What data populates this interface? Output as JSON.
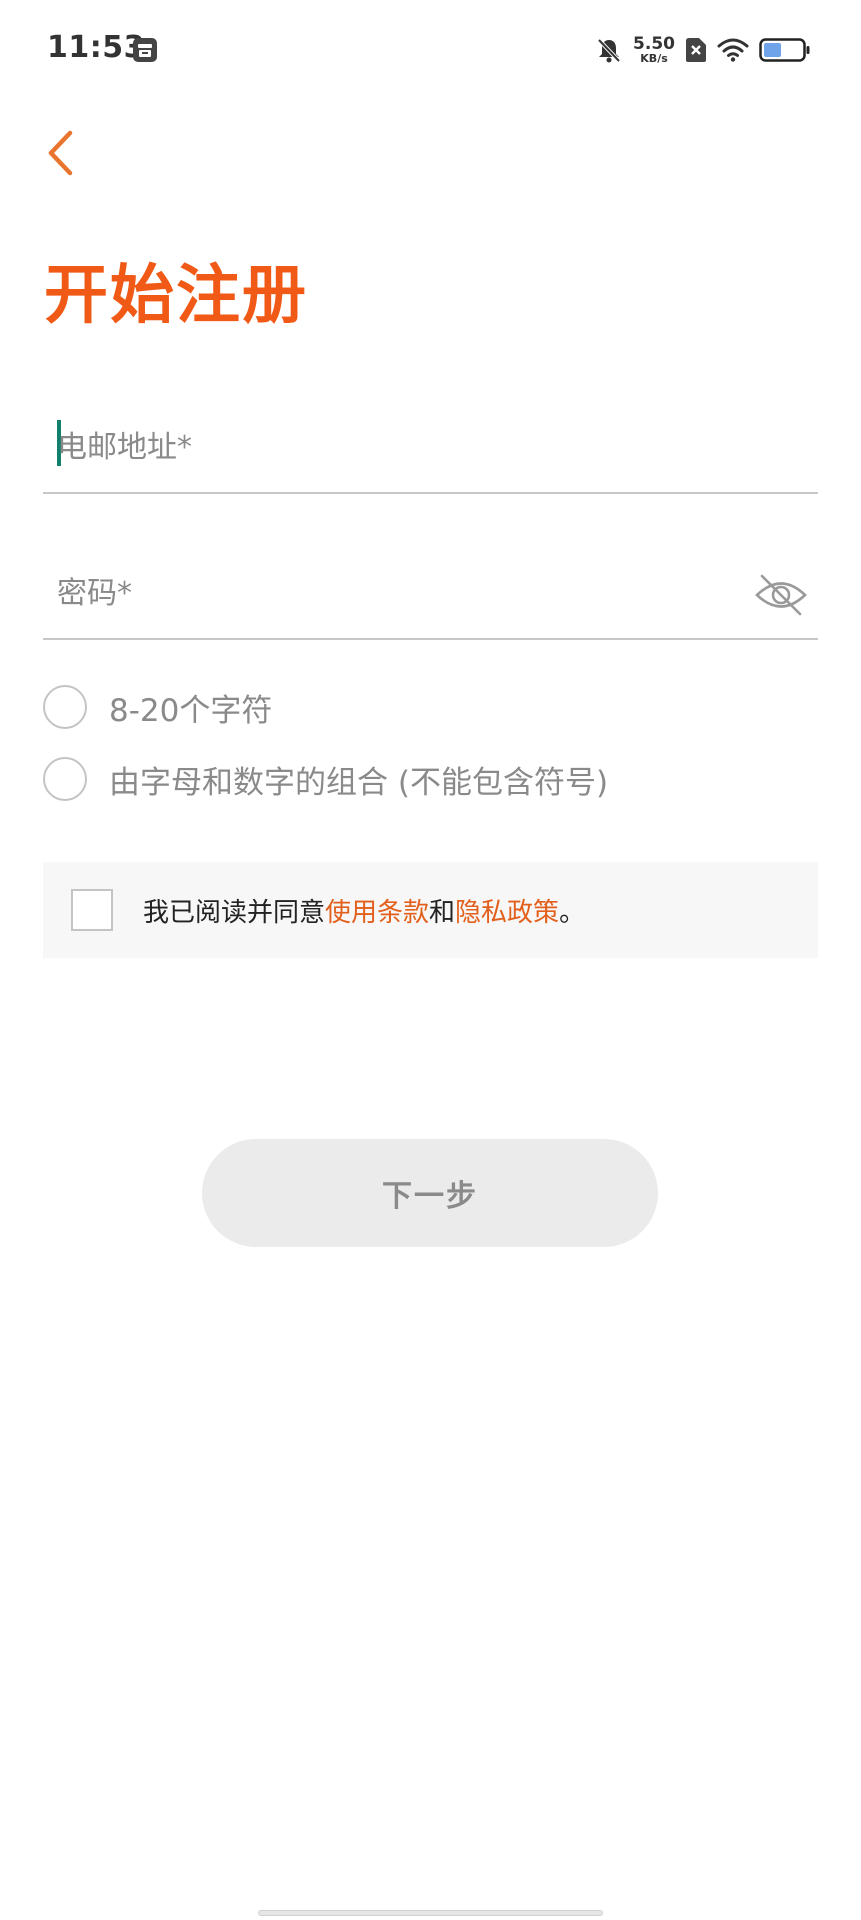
{
  "status_bar": {
    "time": "11:53",
    "net_speed_value": "5.50",
    "net_speed_unit": "KB/s",
    "battery_level": 0.45,
    "icons": [
      "notification-app-icon",
      "bell-muted-icon",
      "sim-no-signal-icon",
      "wifi-icon",
      "battery-icon"
    ]
  },
  "header": {
    "back_icon": "chevron-left-icon",
    "title": "开始注册"
  },
  "form": {
    "email": {
      "placeholder": "电邮地址*",
      "value": ""
    },
    "password": {
      "placeholder": "密码*",
      "value": "",
      "toggle_icon": "eye-off-icon"
    },
    "rules": [
      {
        "text": "8-20个字符",
        "met": false
      },
      {
        "text": "由字母和数字的组合 (不能包含符号)",
        "met": false
      }
    ],
    "agreement": {
      "checked": false,
      "prefix": "我已阅读并同意",
      "terms_link": "使用条款",
      "conjunction": "和",
      "privacy_link": "隐私政策",
      "suffix": "。"
    },
    "next_label": "下一步"
  },
  "colors": {
    "accent": "#f05a16",
    "link": "#e2601b",
    "caret": "#12806a",
    "disabled_button_bg": "#ebebeb"
  }
}
